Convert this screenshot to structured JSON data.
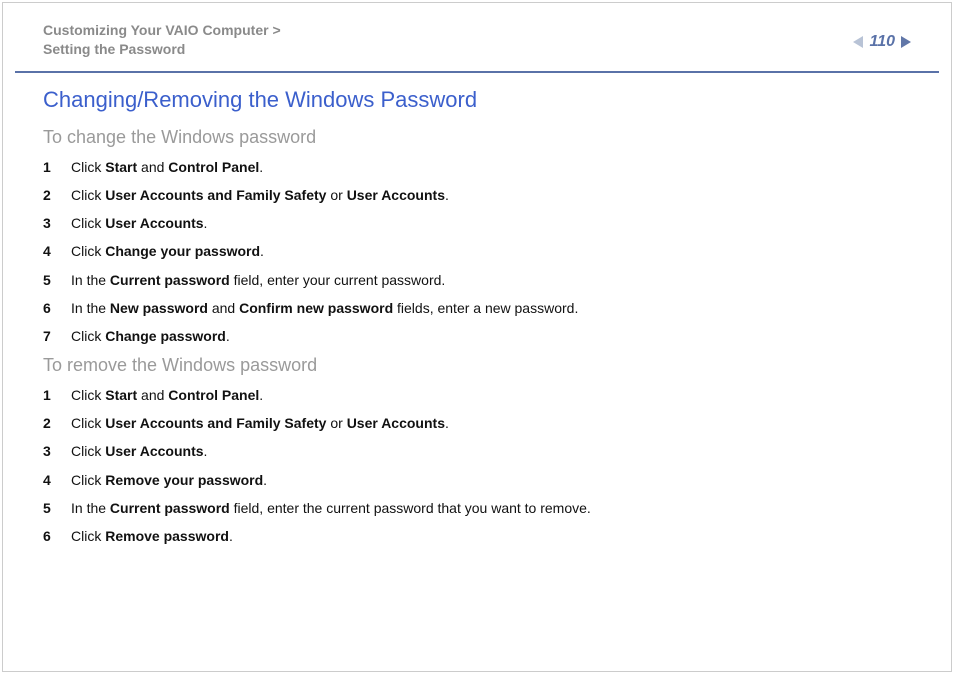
{
  "header": {
    "breadcrumb_line1": "Customizing Your VAIO Computer >",
    "breadcrumb_line2": "Setting the Password",
    "page_number": "110"
  },
  "title": "Changing/Removing the Windows Password",
  "section_change": {
    "subtitle": "To change the Windows password",
    "steps": [
      {
        "num": "1",
        "html": "Click <b>Start</b> and <b>Control Panel</b>."
      },
      {
        "num": "2",
        "html": "Click <b>User Accounts and Family Safety</b> or <b>User Accounts</b>."
      },
      {
        "num": "3",
        "html": "Click <b>User Accounts</b>."
      },
      {
        "num": "4",
        "html": "Click <b>Change your password</b>."
      },
      {
        "num": "5",
        "html": "In the <b>Current password</b> field, enter your current password."
      },
      {
        "num": "6",
        "html": "In the <b>New password</b> and <b>Confirm new password</b> fields, enter a new password."
      },
      {
        "num": "7",
        "html": "Click <b>Change password</b>."
      }
    ]
  },
  "section_remove": {
    "subtitle": "To remove the Windows password",
    "steps": [
      {
        "num": "1",
        "html": "Click <b>Start</b> and <b>Control Panel</b>."
      },
      {
        "num": "2",
        "html": "Click <b>User Accounts and Family Safety</b> or <b>User Accounts</b>."
      },
      {
        "num": "3",
        "html": "Click <b>User Accounts</b>."
      },
      {
        "num": "4",
        "html": "Click <b>Remove your password</b>."
      },
      {
        "num": "5",
        "html": "In the <b>Current password</b> field, enter the current password that you want to remove."
      },
      {
        "num": "6",
        "html": "Click <b>Remove password</b>."
      }
    ]
  }
}
